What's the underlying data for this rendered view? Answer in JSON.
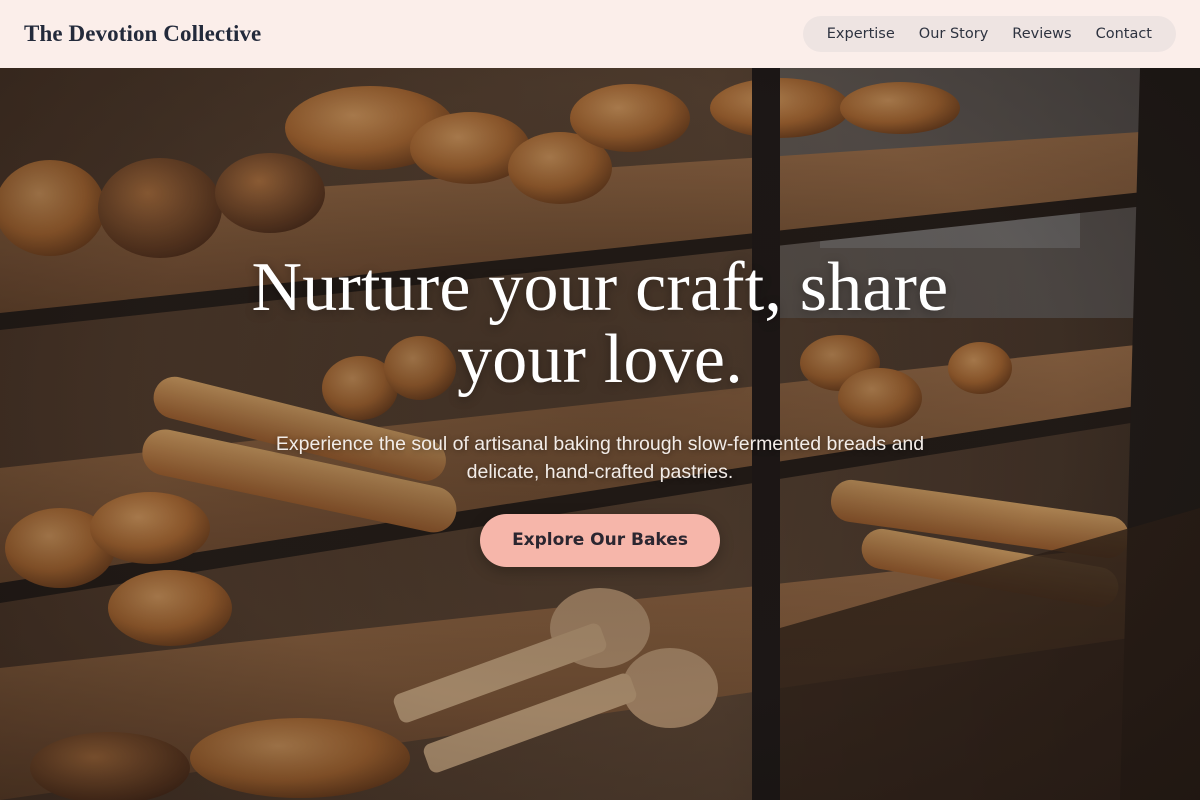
{
  "header": {
    "brand": "The Devotion Collective",
    "nav": [
      {
        "label": "Expertise"
      },
      {
        "label": "Our Story"
      },
      {
        "label": "Reviews"
      },
      {
        "label": "Contact"
      }
    ]
  },
  "hero": {
    "title": "Nurture your craft, share your love.",
    "subtitle": "Experience the soul of artisanal baking through slow-fermented breads and delicate, hand-crafted pastries.",
    "cta_label": "Explore Our Bakes",
    "background_image": "bakery-display-case"
  },
  "colors": {
    "header_bg": "#fbeeea",
    "nav_pill_bg": "#eee4e2",
    "brand_text": "#232a3b",
    "cta_bg": "#f6b6aa",
    "cta_text": "#2b2630"
  }
}
